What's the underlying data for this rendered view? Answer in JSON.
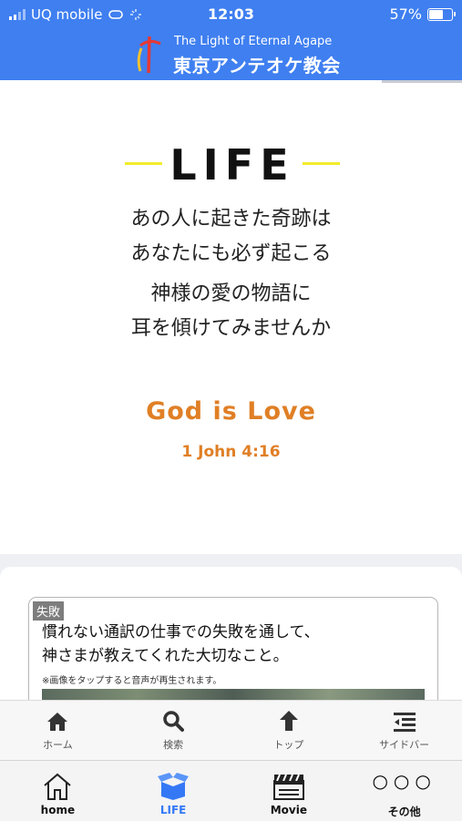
{
  "status_bar": {
    "carrier": "UQ mobile",
    "time": "12:03",
    "battery_percent": "57%",
    "battery_level": 0.57
  },
  "header": {
    "tagline": "The Light of Eternal Agape",
    "church_name": "東京アンテオケ教会"
  },
  "hero": {
    "title": "LIFE",
    "lines_1": [
      "あの人に起きた奇跡は",
      "あなたにも必ず起こる"
    ],
    "lines_2": [
      "神様の愛の物語に",
      "耳を傾けてみませんか"
    ],
    "motto": "God is Love",
    "verse": "1 John 4:16"
  },
  "card": {
    "badge": "失敗",
    "title_lines": [
      "慣れない通訳の仕事での失敗を通して、",
      "神さまが教えてくれた大切なこと。"
    ],
    "note": "※画像をタップすると音声が再生されます。"
  },
  "sub_nav": [
    {
      "label": "ホーム",
      "icon": "home-icon"
    },
    {
      "label": "検索",
      "icon": "search-icon"
    },
    {
      "label": "トップ",
      "icon": "arrow-up-icon"
    },
    {
      "label": "サイドバー",
      "icon": "sidebar-icon"
    }
  ],
  "tab_bar": [
    {
      "label": "home",
      "icon": "house-outline-icon"
    },
    {
      "label": "LIFE",
      "icon": "open-box-icon",
      "active": true
    },
    {
      "label": "Movie",
      "icon": "clapperboard-icon"
    },
    {
      "label": "その他",
      "icon": "more-dots-icon"
    }
  ],
  "colors": {
    "brand_blue": "#3f7ff0",
    "accent_orange": "#e07f25",
    "highlight_yellow": "#f2ec2c",
    "active_tab": "#3478f6"
  }
}
